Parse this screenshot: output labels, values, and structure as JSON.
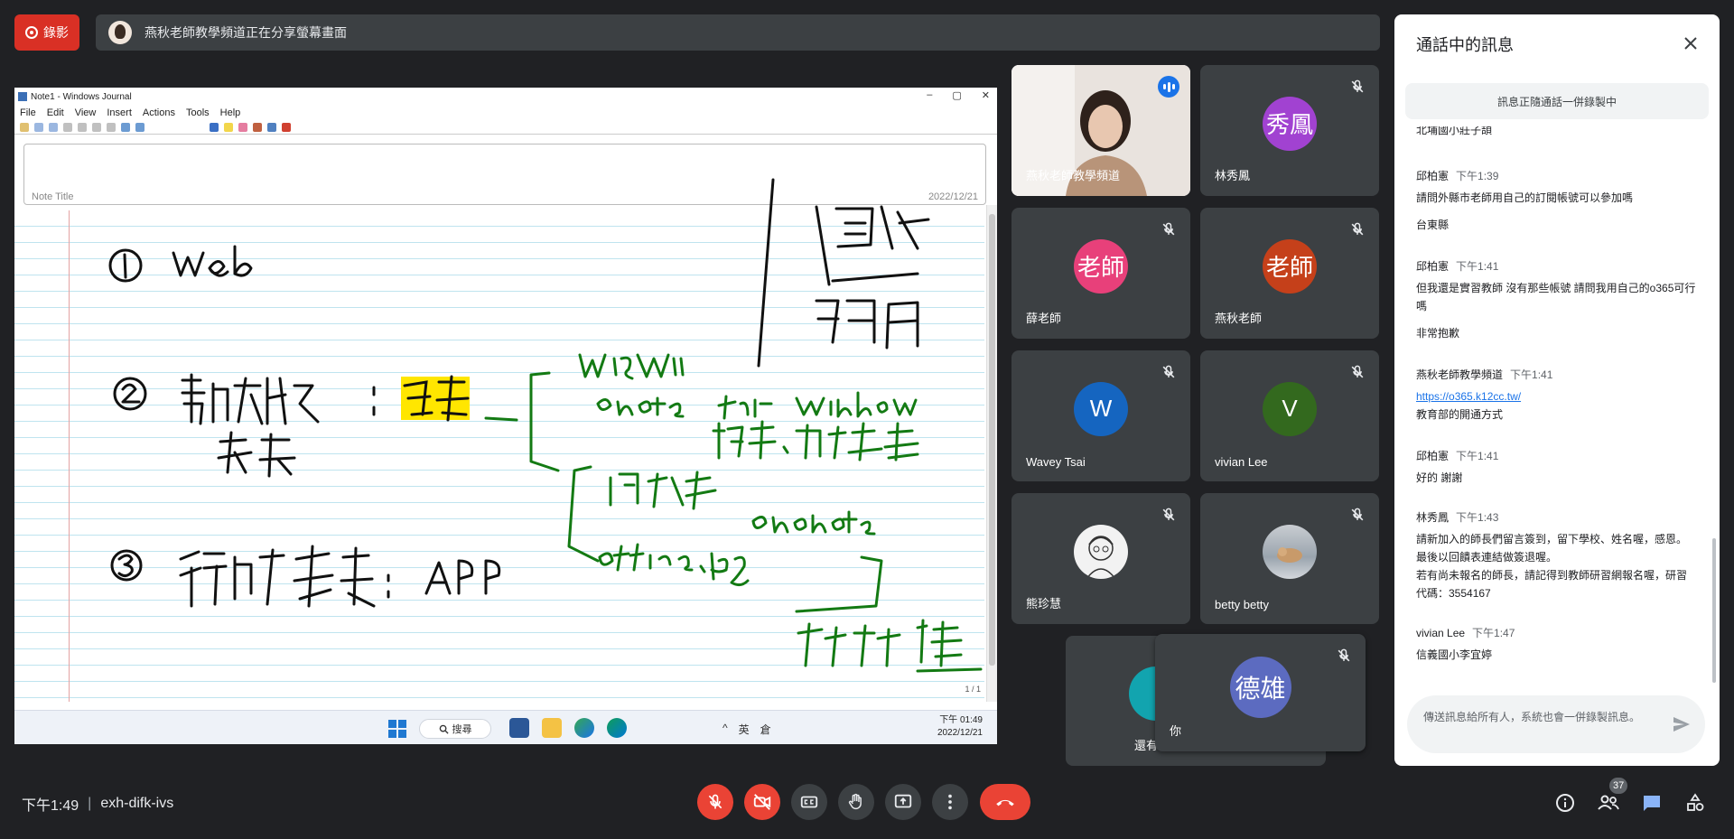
{
  "recording": {
    "label": "錄影",
    "color": "#d93025"
  },
  "share_banner": {
    "text": "燕秋老師教學頻道正在分享螢幕畫面"
  },
  "shared_screen": {
    "window_title": "Note1 - Windows Journal",
    "window_controls": [
      "–",
      "▢",
      "✕"
    ],
    "menu": [
      "File",
      "Edit",
      "View",
      "Insert",
      "Actions",
      "Tools",
      "Help"
    ],
    "note_title_label": "Note Title",
    "note_date": "2022/12/21",
    "page_indicator": "1 / 1",
    "taskbar": {
      "search_label": "搜尋",
      "tray_items": [
        "^",
        "英",
        "倉"
      ],
      "time": "下午 01:49",
      "date": "2022/12/21"
    }
  },
  "participants": [
    {
      "name": "燕秋老師教學頻道",
      "type": "video",
      "speaking": true
    },
    {
      "name": "林秀鳳",
      "initials": "秀鳳",
      "color": "#a142d1",
      "muted": true
    },
    {
      "name": "薛老師",
      "initials": "老師",
      "color": "#e8407a",
      "muted": true
    },
    {
      "name": "燕秋老師",
      "initials": "老師",
      "color": "#c5401a",
      "muted": true
    },
    {
      "name": "Wavey Tsai",
      "initials": "W",
      "color": "#1565c0",
      "muted": true
    },
    {
      "name": "vivian Lee",
      "initials": "V",
      "color": "#33691e",
      "muted": true
    },
    {
      "name": "熊珍慧",
      "type": "photo",
      "muted": true
    },
    {
      "name": "betty betty",
      "type": "photo",
      "muted": true
    },
    {
      "name": "還有",
      "color": "#12a4af"
    },
    {
      "name": "你",
      "initials": "德雄",
      "color": "#5c6bc0",
      "muted": true
    }
  ],
  "chat": {
    "title": "通話中的訊息",
    "notice": "訊息正隨通話一併錄製中",
    "partial_top": "北埔國小莊子頡",
    "messages": [
      {
        "sender": "邱柏憲",
        "time": "下午1:39",
        "lines": [
          "請問外縣市老師用自己的訂閱帳號可以參加嗎",
          "台東縣"
        ]
      },
      {
        "sender": "邱柏憲",
        "time": "下午1:41",
        "lines": [
          "但我還是實習教師 沒有那些帳號 請問我用自己的o365可行嗎",
          "非常抱歉"
        ]
      },
      {
        "sender": "燕秋老師教學頻道",
        "time": "下午1:41",
        "link": "https://o365.k12cc.tw/",
        "lines": [
          "教育部的開通方式"
        ]
      },
      {
        "sender": "邱柏憲",
        "time": "下午1:41",
        "lines": [
          "好的 謝謝"
        ]
      },
      {
        "sender": "林秀鳳",
        "time": "下午1:43",
        "lines": [
          "請新加入的師長們留言簽到，留下學校、姓名喔，感恩。最後以回饋表連結做簽退喔。",
          "若有尚未報名的師長，請記得到教師研習網報名喔，研習代碼：3554167"
        ]
      },
      {
        "sender": "vivian Lee",
        "time": "下午1:47",
        "lines": [
          "信義國小李宜婷"
        ]
      }
    ],
    "input_placeholder": "傳送訊息給所有人，系統也會一併錄製訊息。"
  },
  "bottom_bar": {
    "time": "下午1:49",
    "separator": "|",
    "meeting_code": "exh-difk-ivs",
    "people_count": "37"
  },
  "icons": {
    "mic_off": "mic-off-icon",
    "camera_off": "videocam-off-icon",
    "captions": "cc-icon",
    "raise_hand": "hand-icon",
    "present": "present-icon",
    "more": "more-vert-icon",
    "end_call": "call-end-icon",
    "info": "info-icon",
    "people": "people-icon",
    "chat": "chat-icon",
    "activities": "shapes-icon"
  }
}
